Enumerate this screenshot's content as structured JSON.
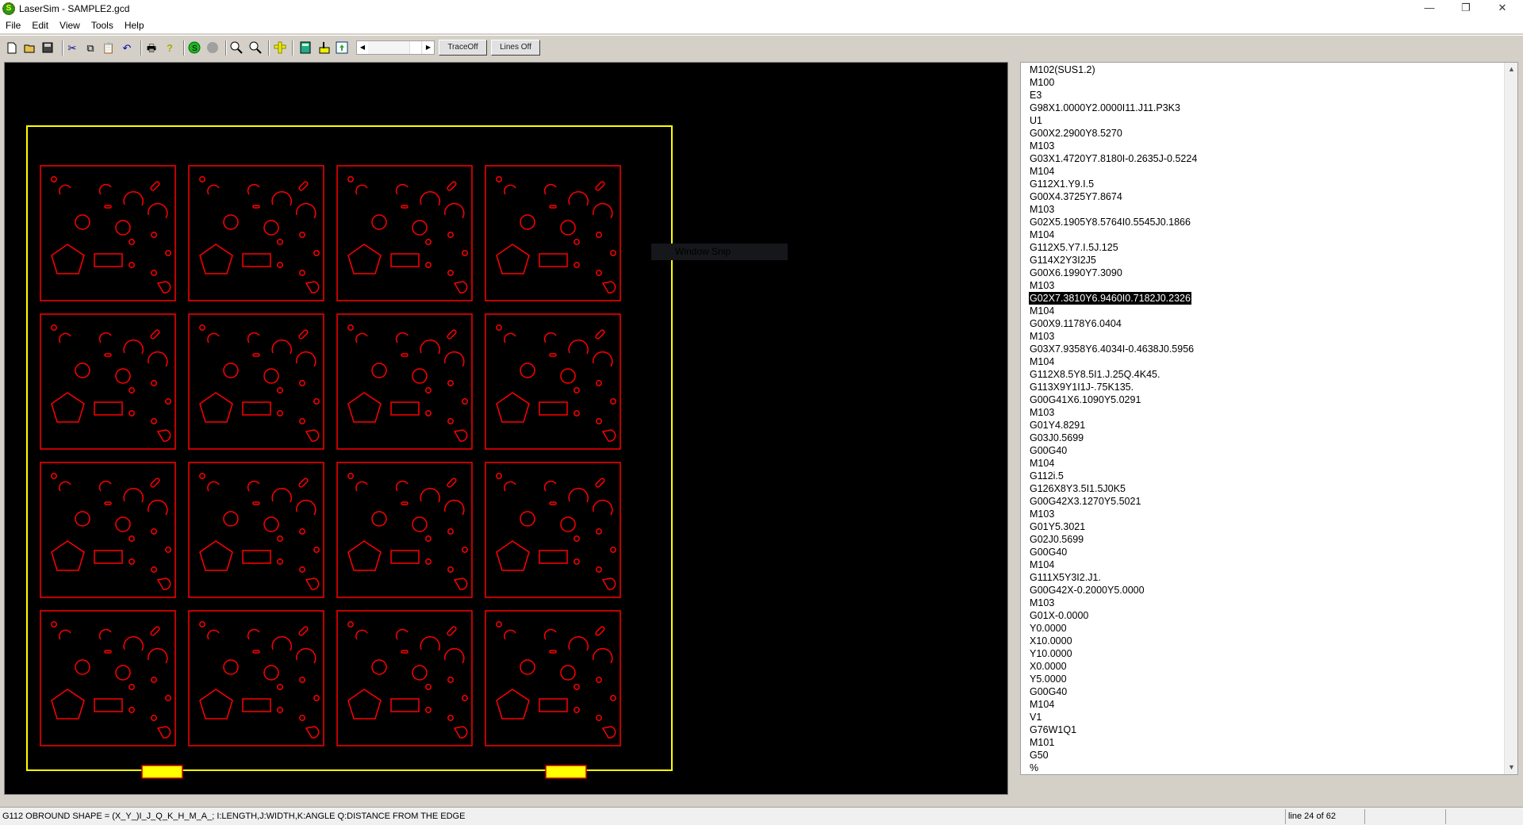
{
  "window": {
    "title": "LaserSim - SAMPLE2.gcd",
    "app_icon": "lasersim-icon",
    "minimize": "—",
    "restore": "❐",
    "close": "✕"
  },
  "menu": [
    "File",
    "Edit",
    "View",
    "Tools",
    "Help"
  ],
  "toolbar": {
    "icons": [
      "new-file-icon",
      "open-folder-icon",
      "save-icon",
      "cut-icon",
      "copy-icon",
      "paste-icon",
      "undo-icon",
      "print-icon",
      "help-icon",
      "start-icon",
      "stop-icon",
      "zoom-icon",
      "zoom-all-icon",
      "measure-icon",
      "calculator-icon",
      "toolpath-icon",
      "export-icon"
    ],
    "trace_button": "TraceOff",
    "lines_button": "Lines Off"
  },
  "canvas": {
    "sheet_color": "#ffff00",
    "part_color": "#ff0000",
    "grid_rows": 4,
    "grid_cols": 4,
    "overlay_label": "Window Snip"
  },
  "code": {
    "selected_index": 18,
    "lines": [
      "M102(SUS1.2)",
      "M100",
      "E3",
      "G98X1.0000Y2.0000I11.J11.P3K3",
      "U1",
      "G00X2.2900Y8.5270",
      "M103",
      "G03X1.4720Y7.8180I-0.2635J-0.5224",
      "M104",
      "G112X1.Y9.I.5",
      "G00X4.3725Y7.8674",
      "M103",
      "G02X5.1905Y8.5764I0.5545J0.1866",
      "M104",
      "G112X5.Y7.I.5J.125",
      "G114X2Y3I2J5",
      "G00X6.1990Y7.3090",
      "M103",
      "G02X7.3810Y6.9460I0.7182J0.2326",
      "M104",
      "G00X9.1178Y6.0404",
      "M103",
      "G03X7.9358Y6.4034I-0.4638J0.5956",
      "M104",
      "G112X8.5Y8.5I1.J.25Q.4K45.",
      "G113X9Y1I1J-.75K135.",
      "G00G41X6.1090Y5.0291",
      "M103",
      "G01Y4.8291",
      "G03J0.5699",
      "G00G40",
      "M104",
      "G112i.5",
      "G126X8Y3.5I1.5J0K5",
      "G00G42X3.1270Y5.5021",
      "M103",
      "G01Y5.3021",
      "G02J0.5699",
      "G00G40",
      "M104",
      "G111X5Y3I2.J1.",
      "G00G42X-0.2000Y5.0000",
      "M103",
      "G01X-0.0000",
      "Y0.0000",
      "X10.0000",
      "Y10.0000",
      "X0.0000",
      "Y5.0000",
      "G00G40",
      "M104",
      "V1",
      "G76W1Q1",
      "M101",
      "G50",
      "%"
    ]
  },
  "status": {
    "message": "G112 OBROUND SHAPE = (X_Y_)I_J_Q_K_H_M_A_;  I:LENGTH,J:WIDTH,K:ANGLE Q:DISTANCE FROM THE EDGE",
    "line_info": "line  24 of 62",
    "panel3": "",
    "panel4": ""
  }
}
